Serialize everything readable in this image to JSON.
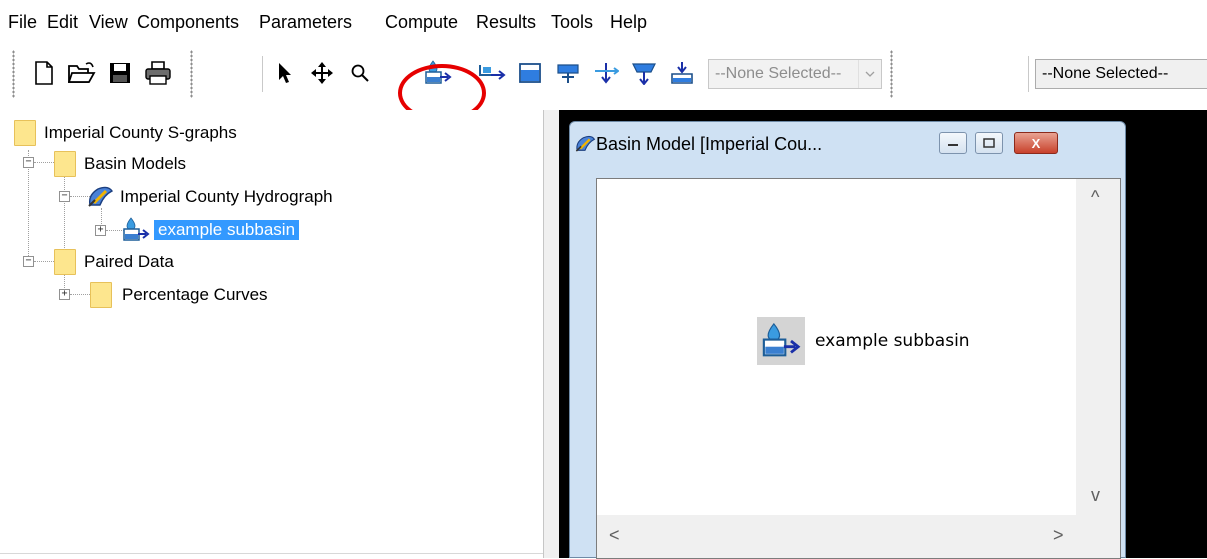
{
  "menu": {
    "items": [
      "File",
      "Edit",
      "View",
      "Components",
      "Parameters",
      "Compute",
      "Results",
      "Tools",
      "Help"
    ]
  },
  "toolbar": {
    "selector_1": "--None Selected--",
    "selector_2": "--None Selected--"
  },
  "tree": {
    "root": "Imperial County S-graphs",
    "basin_models": "Basin Models",
    "basin": "Imperial County Hydrograph",
    "subbasin": "example subbasin",
    "paired_data": "Paired Data",
    "percentage_curves": "Percentage Curves",
    "expand_minus": "−",
    "expand_plus": "+"
  },
  "window": {
    "title": "Basin Model [Imperial Cou...",
    "node_label": "example subbasin",
    "close_glyph": "X",
    "scroll_up": "^",
    "scroll_down": "v",
    "scroll_left": "<",
    "scroll_right": ">"
  },
  "colors": {
    "selection": "#3399ff",
    "highlight": "#e60000",
    "folder": "#fde68e"
  }
}
